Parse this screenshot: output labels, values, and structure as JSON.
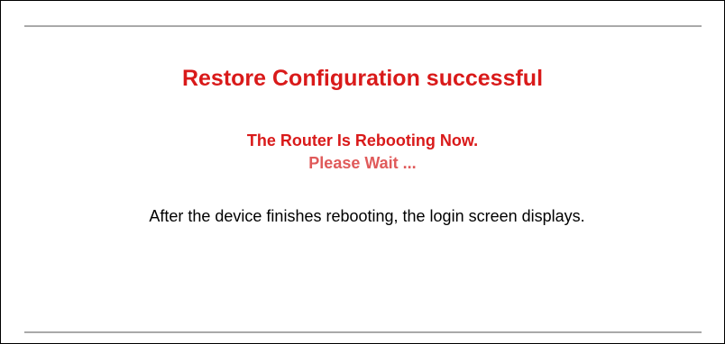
{
  "status": {
    "title": "Restore Configuration successful",
    "rebooting": "The Router Is Rebooting Now.",
    "wait": "Please Wait ...",
    "message": "After the device finishes rebooting, the login screen displays."
  },
  "colors": {
    "title": "#d91a1a",
    "rebooting": "#d91a1a",
    "wait": "#e05a5a",
    "message": "#000000",
    "rule": "#a9a9a9"
  }
}
